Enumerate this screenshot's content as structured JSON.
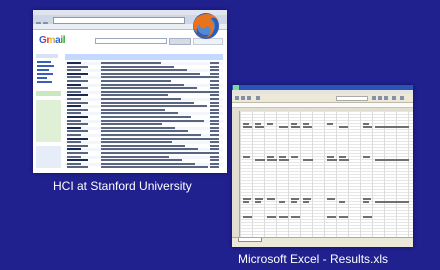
{
  "windows": [
    {
      "id": "browser",
      "caption": "HCI at Stanford University",
      "app_icon": "firefox-icon",
      "content_logo": "Gmail"
    },
    {
      "id": "excel",
      "caption": "Microsoft Excel - Results.xls",
      "app_icon": "excel-icon"
    }
  ],
  "colors": {
    "background": "#20208e",
    "caption_text": "#ffffff",
    "gmail_header": "#c3d9ff",
    "excel_titlebar": "#2a55b8"
  }
}
